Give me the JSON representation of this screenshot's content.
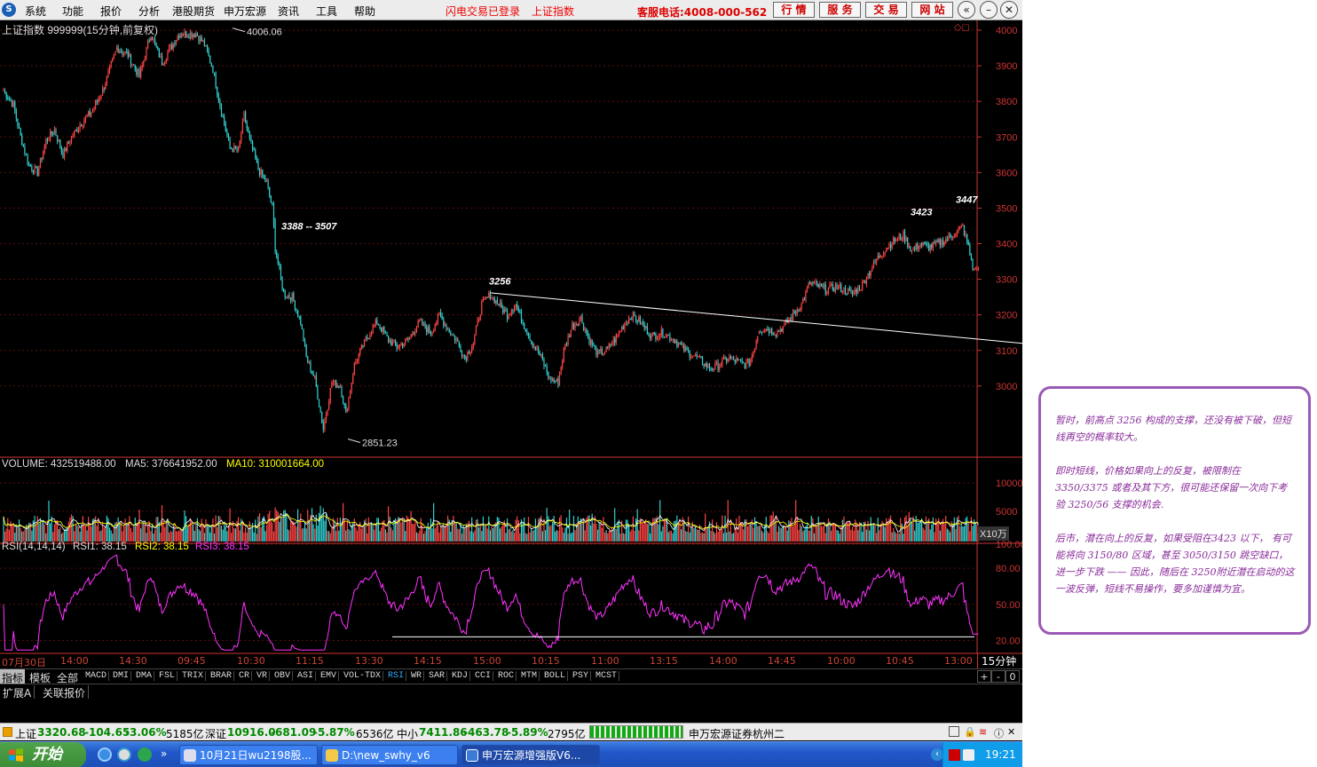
{
  "menu": {
    "items": [
      "系统",
      "功能",
      "报价",
      "分析",
      "港股期货",
      "申万宏源",
      "资讯",
      "工具",
      "帮助"
    ],
    "status_login": "闪电交易已登录",
    "status_index": "上证指数",
    "hotline": "客服电话:4008-000-562",
    "buttons": [
      "行 情",
      "服 务",
      "交 易",
      "网 站"
    ],
    "window_controls": [
      "back-icon",
      "minimize-icon",
      "restore-icon",
      "close-icon"
    ]
  },
  "chart_header": {
    "title": "上证指数 999999(15分钟,前复权)",
    "volume_label": "VOLUME: 432519488.00",
    "ma5_label": "MA5: 376641952.00",
    "ma10_label": "MA10: 310001664.00",
    "rsi_label": "RSI(14,14,14)",
    "rsi1_label": "RSI1: 38.15",
    "rsi2_label": "RSI2: 38.15",
    "rsi3_label": "RSI3: 38.15",
    "volume_unit": "X10万"
  },
  "chart_data": {
    "type": "candlestick",
    "price_axis": {
      "ticks": [
        4000,
        3900,
        3800,
        3700,
        3600,
        3500,
        3400,
        3300,
        3200,
        3100,
        3000
      ],
      "ylim": [
        2800,
        4020
      ]
    },
    "volume_axis": {
      "ticks": [
        10000,
        5000
      ],
      "unit": "X10万"
    },
    "rsi_axis": {
      "ticks": [
        "100.00",
        "80.00",
        "50.00",
        "20.00"
      ],
      "ylim": [
        10,
        100
      ]
    },
    "time_labels": [
      "07月30日",
      "14:00",
      "14:30",
      "09:45",
      "10:30",
      "11:15",
      "13:30",
      "14:15",
      "15:00",
      "10:15",
      "11:00",
      "13:15",
      "14:00",
      "14:45",
      "10:00",
      "10:45",
      "13:00"
    ],
    "period_label": "15分钟",
    "annotations": [
      {
        "text": "4006.06",
        "value": 4006.06
      },
      {
        "text": "2851.23",
        "value": 2851.23
      },
      {
        "text": "3388 -- 3507"
      },
      {
        "text": "3256",
        "value": 3256
      },
      {
        "text": "3423",
        "value": 3423
      },
      {
        "text": "3447",
        "value": 3447
      }
    ],
    "anchors": [
      [
        0,
        3830
      ],
      [
        7,
        3790
      ],
      [
        12,
        3700
      ],
      [
        18,
        3620
      ],
      [
        24,
        3600
      ],
      [
        30,
        3690
      ],
      [
        36,
        3720
      ],
      [
        42,
        3650
      ],
      [
        48,
        3700
      ],
      [
        55,
        3740
      ],
      [
        62,
        3770
      ],
      [
        70,
        3830
      ],
      [
        80,
        3950
      ],
      [
        88,
        3930
      ],
      [
        96,
        3870
      ],
      [
        104,
        3990
      ],
      [
        112,
        3910
      ],
      [
        118,
        3950
      ],
      [
        124,
        3990
      ],
      [
        130,
        3990
      ],
      [
        136,
        3990
      ],
      [
        142,
        3960
      ],
      [
        148,
        3890
      ],
      [
        154,
        3770
      ],
      [
        160,
        3670
      ],
      [
        166,
        3660
      ],
      [
        170,
        3760
      ],
      [
        174,
        3690
      ],
      [
        180,
        3610
      ],
      [
        186,
        3570
      ],
      [
        190,
        3500
      ],
      [
        192,
        3388
      ],
      [
        198,
        3260
      ],
      [
        204,
        3250
      ],
      [
        210,
        3180
      ],
      [
        214,
        3080
      ],
      [
        220,
        3020
      ],
      [
        226,
        2880
      ],
      [
        232,
        3010
      ],
      [
        238,
        3000
      ],
      [
        242,
        2920
      ],
      [
        248,
        3060
      ],
      [
        256,
        3130
      ],
      [
        264,
        3180
      ],
      [
        272,
        3130
      ],
      [
        278,
        3110
      ],
      [
        286,
        3130
      ],
      [
        294,
        3180
      ],
      [
        302,
        3150
      ],
      [
        308,
        3200
      ],
      [
        314,
        3160
      ],
      [
        320,
        3130
      ],
      [
        326,
        3080
      ],
      [
        332,
        3120
      ],
      [
        338,
        3230
      ],
      [
        344,
        3256
      ],
      [
        350,
        3230
      ],
      [
        356,
        3200
      ],
      [
        362,
        3230
      ],
      [
        368,
        3170
      ],
      [
        374,
        3120
      ],
      [
        380,
        3080
      ],
      [
        386,
        3020
      ],
      [
        392,
        3010
      ],
      [
        396,
        3100
      ],
      [
        402,
        3170
      ],
      [
        408,
        3190
      ],
      [
        414,
        3130
      ],
      [
        420,
        3090
      ],
      [
        426,
        3100
      ],
      [
        432,
        3130
      ],
      [
        438,
        3170
      ],
      [
        444,
        3200
      ],
      [
        450,
        3180
      ],
      [
        458,
        3140
      ],
      [
        466,
        3150
      ],
      [
        474,
        3130
      ],
      [
        482,
        3100
      ],
      [
        490,
        3080
      ],
      [
        496,
        3060
      ],
      [
        500,
        3050
      ],
      [
        506,
        3060
      ],
      [
        512,
        3080
      ],
      [
        518,
        3070
      ],
      [
        524,
        3060
      ],
      [
        528,
        3070
      ],
      [
        534,
        3160
      ],
      [
        540,
        3160
      ],
      [
        546,
        3150
      ],
      [
        552,
        3170
      ],
      [
        558,
        3200
      ],
      [
        564,
        3230
      ],
      [
        570,
        3290
      ],
      [
        576,
        3280
      ],
      [
        582,
        3270
      ],
      [
        588,
        3280
      ],
      [
        594,
        3270
      ],
      [
        600,
        3260
      ],
      [
        606,
        3280
      ],
      [
        612,
        3320
      ],
      [
        618,
        3360
      ],
      [
        624,
        3390
      ],
      [
        630,
        3410
      ],
      [
        636,
        3423
      ],
      [
        642,
        3380
      ],
      [
        648,
        3400
      ],
      [
        654,
        3390
      ],
      [
        660,
        3400
      ],
      [
        666,
        3410
      ],
      [
        672,
        3430
      ],
      [
        678,
        3447
      ],
      [
        682,
        3390
      ],
      [
        686,
        3320
      ]
    ],
    "bars_total": 690,
    "trendline": {
      "from_bar": 344,
      "from_value": 3262,
      "to_bar": 690,
      "to_value": 3120
    },
    "rsi_hline": 23
  },
  "time_axis": {
    "labels": [
      "07月30日",
      "14:00",
      "14:30",
      "09:45",
      "10:30",
      "11:15",
      "13:30",
      "14:15",
      "15:00",
      "10:15",
      "11:00",
      "13:15",
      "14:00",
      "14:45",
      "10:00",
      "10:45",
      "13:00"
    ],
    "period": "15分钟"
  },
  "indicator_tabs": {
    "categories": [
      "指标",
      "模板",
      "全部"
    ],
    "items": [
      "MACD",
      "DMI",
      "DMA",
      "FSL",
      "TRIX",
      "BRAR",
      "CR",
      "VR",
      "OBV",
      "ASI",
      "EMV",
      "VOL-TDX",
      "RSI",
      "WR",
      "SAR",
      "KDJ",
      "CCI",
      "ROC",
      "MTM",
      "BOLL",
      "PSY",
      "MCST"
    ],
    "selected": "RSI",
    "right_buttons": [
      "+",
      "-",
      "0"
    ]
  },
  "lower_tabs": [
    "扩展A",
    "关联报价"
  ],
  "status_bar": {
    "sh_name": "上证",
    "sh_price": "3320.68",
    "sh_change": "-104.65",
    "sh_pct": "-3.06%",
    "sh_amount": "5185亿",
    "sz_name": "深证",
    "sz_price": "10916.0",
    "sz_change": "-681.09",
    "sz_pct": "-5.87%",
    "sz_amount": "6536亿",
    "zx_name": "中小",
    "zx_price": "7411.86",
    "zx_change": "-463.78",
    "zx_pct": "-5.89%",
    "zx_amount": "2795亿",
    "broker": "申万宏源证券杭州二",
    "up_color": "#008800",
    "down_color": "#008800"
  },
  "taskbar": {
    "start_label": "开始",
    "tasks": [
      {
        "label": "10月21日wu2198股...",
        "active": false
      },
      {
        "label": "D:\\new_swhy_v6",
        "active": false
      },
      {
        "label": "申万宏源增强版V6...",
        "active": true
      }
    ],
    "clock": "19:21"
  },
  "note": {
    "p1": "暂时，前高点 3256 构成的支撑，还没有被下破，但短线再空的概率较大。",
    "p2": "即时短线，价格如果向上的反复，被限制在 3350/3375 或者及其下方，很可能还保留一次向下考验 3250/56 支撑的机会.",
    "p3": "后市，潜在向上的反复，如果受阻在3423 以下， 有可能将向 3150/80 区域，甚至 3050/3150 跳空缺口，进一步下跌 —— 因此，随后在 3250附近潜在启动的这一波反弹，短线不易操作，要多加谨慎为宜。"
  },
  "colors": {
    "up": "#ff4444",
    "down": "#33d0d0",
    "axis": "#c33",
    "ma5": "#ffffff",
    "ma10": "#ffff00",
    "rsi": "#ff33ff",
    "note_border": "#9b59b6"
  }
}
